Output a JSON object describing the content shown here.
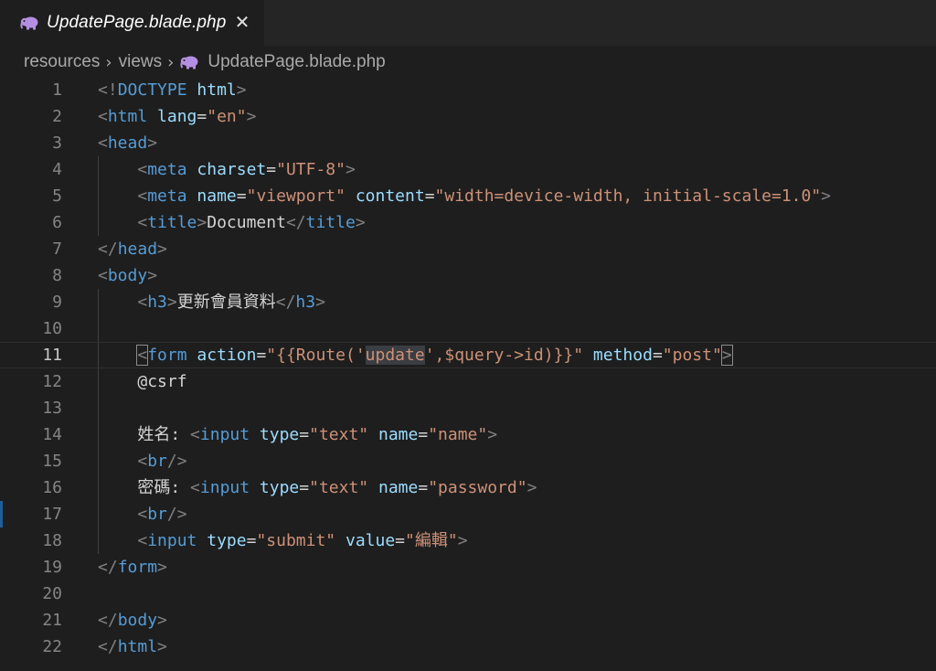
{
  "tab": {
    "filename": "UpdatePage.blade.php",
    "close": "✕"
  },
  "breadcrumb": {
    "part1": "resources",
    "part2": "views",
    "part3": "UpdatePage.blade.php"
  },
  "gutter": [
    "1",
    "2",
    "3",
    "4",
    "5",
    "6",
    "7",
    "8",
    "9",
    "10",
    "11",
    "12",
    "13",
    "14",
    "15",
    "16",
    "17",
    "18",
    "19",
    "20",
    "21",
    "22"
  ],
  "code": {
    "l1": [
      [
        "<!",
        "punc"
      ],
      [
        "DOCTYPE",
        "tag"
      ],
      [
        " ",
        "txt"
      ],
      [
        "html",
        "attr"
      ],
      [
        ">",
        "punc"
      ]
    ],
    "l2": [
      [
        "<",
        "punc"
      ],
      [
        "html",
        "tag"
      ],
      [
        " ",
        "txt"
      ],
      [
        "lang",
        "attr"
      ],
      [
        "=",
        "txt"
      ],
      [
        "\"en\"",
        "str"
      ],
      [
        ">",
        "punc"
      ]
    ],
    "l3": [
      [
        "<",
        "punc"
      ],
      [
        "head",
        "tag"
      ],
      [
        ">",
        "punc"
      ]
    ],
    "l4": [
      [
        "    ",
        "txt"
      ],
      [
        "<",
        "punc"
      ],
      [
        "meta",
        "tag"
      ],
      [
        " ",
        "txt"
      ],
      [
        "charset",
        "attr"
      ],
      [
        "=",
        "txt"
      ],
      [
        "\"UTF-8\"",
        "str"
      ],
      [
        ">",
        "punc"
      ]
    ],
    "l5": [
      [
        "    ",
        "txt"
      ],
      [
        "<",
        "punc"
      ],
      [
        "meta",
        "tag"
      ],
      [
        " ",
        "txt"
      ],
      [
        "name",
        "attr"
      ],
      [
        "=",
        "txt"
      ],
      [
        "\"viewport\"",
        "str"
      ],
      [
        " ",
        "txt"
      ],
      [
        "content",
        "attr"
      ],
      [
        "=",
        "txt"
      ],
      [
        "\"width=device-width, initial-scale=1.0\"",
        "str"
      ],
      [
        ">",
        "punc"
      ]
    ],
    "l6": [
      [
        "    ",
        "txt"
      ],
      [
        "<",
        "punc"
      ],
      [
        "title",
        "tag"
      ],
      [
        ">",
        "punc"
      ],
      [
        "Document",
        "txt"
      ],
      [
        "</",
        "punc"
      ],
      [
        "title",
        "tag"
      ],
      [
        ">",
        "punc"
      ]
    ],
    "l7": [
      [
        "</",
        "punc"
      ],
      [
        "head",
        "tag"
      ],
      [
        ">",
        "punc"
      ]
    ],
    "l8": [
      [
        "<",
        "punc"
      ],
      [
        "body",
        "tag"
      ],
      [
        ">",
        "punc"
      ]
    ],
    "l9": [
      [
        "    ",
        "txt"
      ],
      [
        "<",
        "punc"
      ],
      [
        "h3",
        "tag"
      ],
      [
        ">",
        "punc"
      ],
      [
        "更新會員資料",
        "txt"
      ],
      [
        "</",
        "punc"
      ],
      [
        "h3",
        "tag"
      ],
      [
        ">",
        "punc"
      ]
    ],
    "l10": [],
    "l11": [
      [
        "    ",
        "txt"
      ],
      [
        "<",
        "punc bkt"
      ],
      [
        "form",
        "tag"
      ],
      [
        " ",
        "txt"
      ],
      [
        "action",
        "attr"
      ],
      [
        "=",
        "txt"
      ],
      [
        "\"{{Route('",
        "str"
      ],
      [
        "update",
        "str hl"
      ],
      [
        "',$query->id)}}\"",
        "str"
      ],
      [
        " ",
        "txt"
      ],
      [
        "method",
        "attr"
      ],
      [
        "=",
        "txt"
      ],
      [
        "\"post\"",
        "str"
      ],
      [
        ">",
        "punc bkt"
      ]
    ],
    "l12": [
      [
        "    ",
        "txt"
      ],
      [
        "@csrf",
        "txt"
      ]
    ],
    "l13": [],
    "l14": [
      [
        "    ",
        "txt"
      ],
      [
        "姓名: ",
        "txt"
      ],
      [
        "<",
        "punc"
      ],
      [
        "input",
        "tag"
      ],
      [
        " ",
        "txt"
      ],
      [
        "type",
        "attr"
      ],
      [
        "=",
        "txt"
      ],
      [
        "\"text\"",
        "str"
      ],
      [
        " ",
        "txt"
      ],
      [
        "name",
        "attr"
      ],
      [
        "=",
        "txt"
      ],
      [
        "\"name\"",
        "str"
      ],
      [
        ">",
        "punc"
      ]
    ],
    "l15": [
      [
        "    ",
        "txt"
      ],
      [
        "<",
        "punc"
      ],
      [
        "br",
        "tag"
      ],
      [
        "/>",
        "punc"
      ]
    ],
    "l16": [
      [
        "    ",
        "txt"
      ],
      [
        "密碼: ",
        "txt"
      ],
      [
        "<",
        "punc"
      ],
      [
        "input",
        "tag"
      ],
      [
        " ",
        "txt"
      ],
      [
        "type",
        "attr"
      ],
      [
        "=",
        "txt"
      ],
      [
        "\"text\"",
        "str"
      ],
      [
        " ",
        "txt"
      ],
      [
        "name",
        "attr"
      ],
      [
        "=",
        "txt"
      ],
      [
        "\"password\"",
        "str"
      ],
      [
        ">",
        "punc"
      ]
    ],
    "l17": [
      [
        "    ",
        "txt"
      ],
      [
        "<",
        "punc"
      ],
      [
        "br",
        "tag"
      ],
      [
        "/>",
        "punc"
      ]
    ],
    "l18": [
      [
        "    ",
        "txt"
      ],
      [
        "<",
        "punc"
      ],
      [
        "input",
        "tag"
      ],
      [
        " ",
        "txt"
      ],
      [
        "type",
        "attr"
      ],
      [
        "=",
        "txt"
      ],
      [
        "\"submit\"",
        "str"
      ],
      [
        " ",
        "txt"
      ],
      [
        "value",
        "attr"
      ],
      [
        "=",
        "txt"
      ],
      [
        "\"編輯\"",
        "str"
      ],
      [
        ">",
        "punc"
      ]
    ],
    "l19": [
      [
        "</",
        "punc"
      ],
      [
        "form",
        "tag"
      ],
      [
        ">",
        "punc"
      ]
    ],
    "l20": [],
    "l21": [
      [
        "</",
        "punc"
      ],
      [
        "body",
        "tag"
      ],
      [
        ">",
        "punc"
      ]
    ],
    "l22": [
      [
        "</",
        "punc"
      ],
      [
        "html",
        "tag"
      ],
      [
        ">",
        "punc"
      ]
    ]
  },
  "colors": {
    "background": "#1e1e1e",
    "tag": "#569cd6",
    "attribute": "#9cdcfe",
    "string": "#ce9178",
    "punctuation": "#808080",
    "text": "#d4d4d4",
    "line_number": "#858585"
  },
  "icons": {
    "tab": "php-elephant-icon",
    "breadcrumb_separator": "chevron-right-icon"
  }
}
